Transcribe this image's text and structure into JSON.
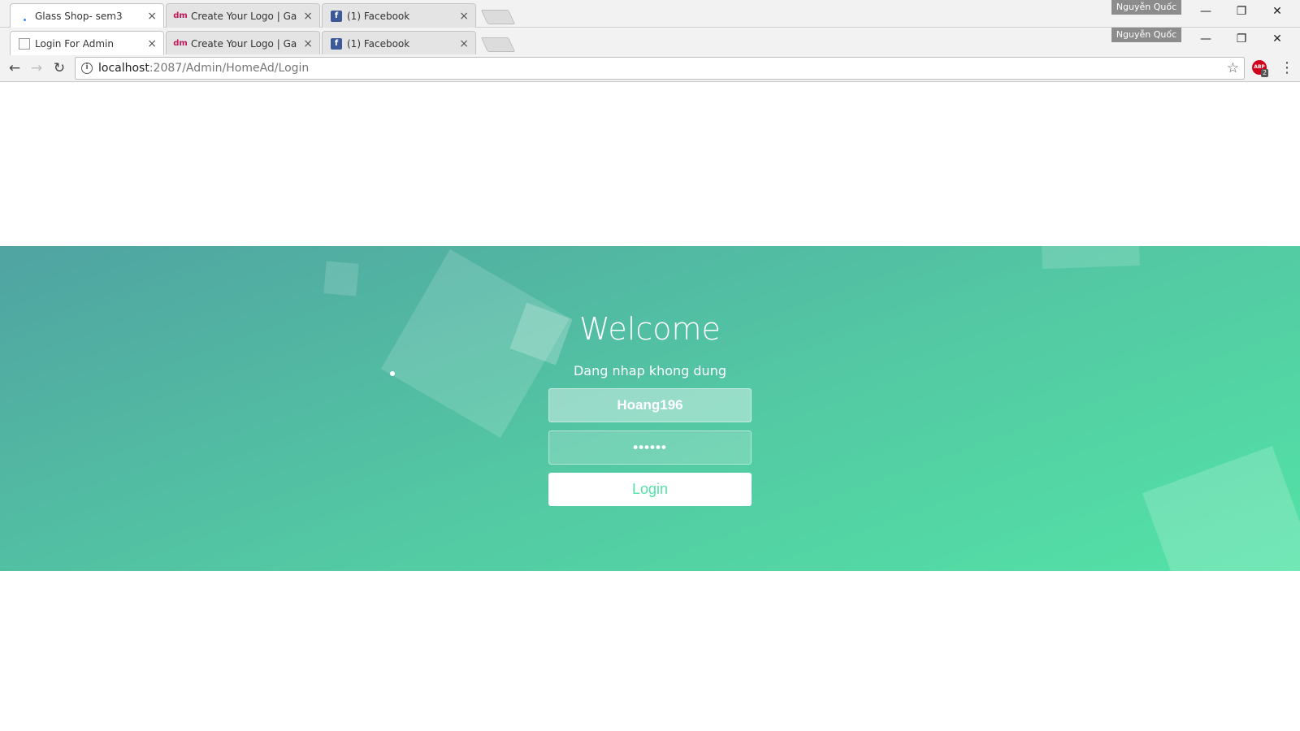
{
  "window_back": {
    "tabs": [
      {
        "label": "Glass Shop- sem3",
        "active": true
      },
      {
        "label": "Create Your Logo | Galler",
        "active": false
      },
      {
        "label": "(1) Facebook",
        "active": false
      }
    ],
    "profile": "Nguyễn Quốc"
  },
  "window_front": {
    "tabs": [
      {
        "label": "Login For Admin",
        "active": true
      },
      {
        "label": "Create Your Logo | Galler",
        "active": false
      },
      {
        "label": "(1) Facebook",
        "active": false
      }
    ],
    "profile": "Nguyễn Quốc"
  },
  "icons": {
    "close": "×",
    "minimize": "—",
    "restore": "❐",
    "window_close": "✕",
    "back": "←",
    "forward": "→",
    "reload": "↻",
    "info": "i",
    "star": "☆",
    "menu": "⋮",
    "tab_logo_favicon": "dm",
    "facebook_favicon": "f"
  },
  "address": {
    "host": "localhost",
    "path": ":2087/Admin/HomeAd/Login"
  },
  "extension": {
    "name": "ABP",
    "badge": "2"
  },
  "login": {
    "title": "Welcome",
    "error": "Dang nhap khong dung",
    "username_value": "Hoang196",
    "password_value": "••••••",
    "button_label": "Login"
  },
  "colors": {
    "gradient_start": "#50a3a2",
    "gradient_end": "#53e3a6",
    "button_text": "#53e3a6",
    "abp": "#d0021b"
  }
}
